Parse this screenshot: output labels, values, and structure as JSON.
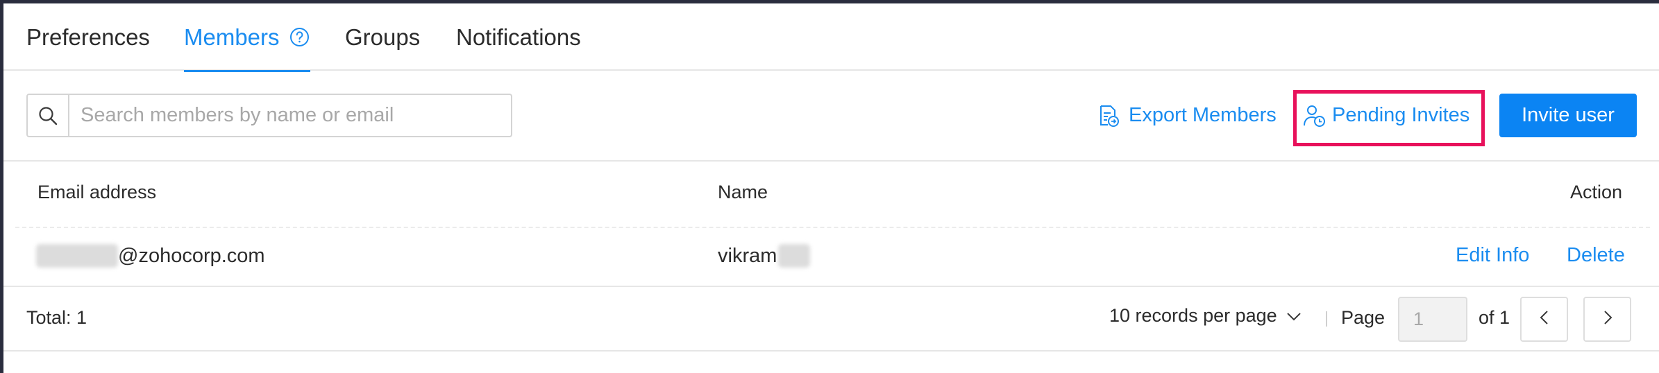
{
  "tabs": [
    {
      "label": "Preferences",
      "active": false
    },
    {
      "label": "Members",
      "active": true
    },
    {
      "label": "Groups",
      "active": false
    },
    {
      "label": "Notifications",
      "active": false
    }
  ],
  "toolbar": {
    "search_placeholder": "Search members by name or email",
    "search_value": "",
    "export_label": "Export Members",
    "pending_label": "Pending Invites",
    "invite_label": "Invite user"
  },
  "table": {
    "columns": [
      "Email address",
      "Name",
      "Action"
    ],
    "rows": [
      {
        "email_visible": "@zohocorp.com",
        "name_visible": "vikram",
        "actions": [
          "Edit Info",
          "Delete"
        ]
      }
    ]
  },
  "footer": {
    "total_label": "Total: 1",
    "per_page_label": "10 records per page",
    "page_label": "Page",
    "page_value": "1",
    "of_label": "of 1"
  },
  "colors": {
    "accent": "#1a8cf0",
    "primary_button": "#0b84f3",
    "highlight_box": "#e8115b",
    "frame": "#2a2d3e"
  },
  "icons": [
    "help-icon",
    "search-icon",
    "export-icon",
    "pending-invites-icon",
    "chevron-down-icon",
    "chevron-left-icon",
    "chevron-right-icon"
  ]
}
